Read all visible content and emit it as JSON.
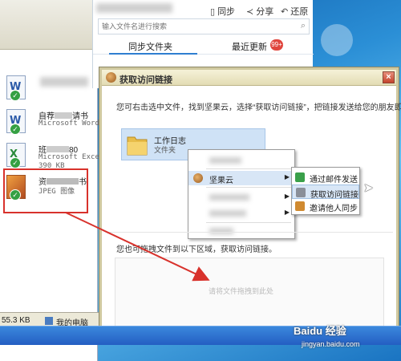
{
  "app": {
    "toolbar": {
      "sync": "同步",
      "share": "分享",
      "restore": "还原"
    },
    "search_placeholder": "输入文件名进行搜索",
    "tabs": [
      {
        "label": "同步文件夹"
      },
      {
        "label": "最近更新"
      }
    ],
    "badge": "99+"
  },
  "explorer": {
    "files": [
      {
        "name": "",
        "desc": "",
        "glyph": "W",
        "color": "#2b5aa8"
      },
      {
        "name": "自荐",
        "name_tail": "请书",
        "desc": "Microsoft Word",
        "glyph": "W",
        "color": "#2b5aa8"
      },
      {
        "name": "班",
        "name_tail": "80",
        "desc": "Microsoft Excel",
        "desc2": "390 KB",
        "glyph": "X",
        "color": "#2a8a3a"
      },
      {
        "name": "资",
        "name_tail": "书",
        "desc": "JPEG 图像",
        "glyph": "",
        "color": "#c86a28"
      }
    ],
    "status": {
      "size": "55.3 KB",
      "location": "我的电脑"
    }
  },
  "dialog": {
    "title": "获取访问链接",
    "close": "×",
    "instruction": "您可右击选中文件，找到坚果云，选择“获取访问链接”，把链接发送给您的朋友即可。",
    "folder": {
      "name": "工作日志",
      "type": "文件夹"
    },
    "context_menu": [
      {
        "label": "",
        "has_sub": false
      },
      {
        "label": "坚果云",
        "has_sub": true
      },
      {
        "label": "",
        "has_sub": true
      },
      {
        "label": "",
        "has_sub": true
      },
      {
        "label": "",
        "has_sub": false
      }
    ],
    "submenu": [
      {
        "label": "通过邮件发送",
        "icon_color": "#3aa04a"
      },
      {
        "label": "获取访问链接",
        "icon_color": "#8a8f99"
      },
      {
        "label": "邀请他人同步",
        "icon_color": "#d08a30"
      }
    ],
    "drop_label": "您也可拖拽文件到以下区域，获取访问链接。",
    "drop_hint": "请将文件拖拽到此处"
  },
  "watermark": {
    "brand": "Baidu 经验",
    "url": "jingyan.baidu.com"
  },
  "colors": {
    "accent": "#2f7fd0",
    "highlight": "#cfe2f6",
    "annotation": "#d8322c"
  }
}
